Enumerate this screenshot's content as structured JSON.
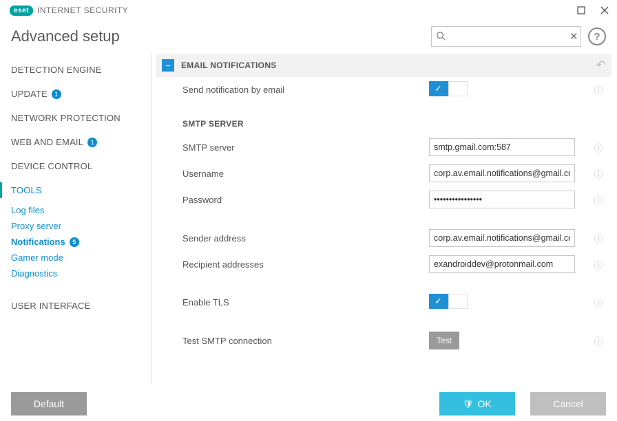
{
  "titlebar": {
    "brand": "eset",
    "product": "INTERNET SECURITY"
  },
  "header": {
    "title": "Advanced setup",
    "search_placeholder": ""
  },
  "sidebar": {
    "items": [
      {
        "label": "DETECTION ENGINE",
        "badge": null
      },
      {
        "label": "UPDATE",
        "badge": "1"
      },
      {
        "label": "NETWORK PROTECTION",
        "badge": null
      },
      {
        "label": "WEB AND EMAIL",
        "badge": "1"
      },
      {
        "label": "DEVICE CONTROL",
        "badge": null
      },
      {
        "label": "TOOLS",
        "badge": null
      },
      {
        "label": "USER INTERFACE",
        "badge": null
      }
    ],
    "tools_sub": [
      {
        "label": "Log files"
      },
      {
        "label": "Proxy server"
      },
      {
        "label": "Notifications",
        "badge": "5"
      },
      {
        "label": "Gamer mode"
      },
      {
        "label": "Diagnostics"
      }
    ]
  },
  "section": {
    "title": "EMAIL NOTIFICATIONS",
    "send_label": "Send notification by email",
    "send_on": true,
    "smtp_title": "SMTP SERVER",
    "server_label": "SMTP server",
    "server_value": "smtp.gmail.com:587",
    "user_label": "Username",
    "user_value": "corp.av.email.notifications@gmail.com",
    "pass_label": "Password",
    "pass_value": "••••••••••••••••",
    "sender_label": "Sender address",
    "sender_value": "corp.av.email.notifications@gmail.com",
    "recip_label": "Recipient addresses",
    "recip_value": "exandroiddev@protonmail.com",
    "tls_label": "Enable TLS",
    "tls_on": true,
    "test_label": "Test SMTP connection",
    "test_btn": "Test"
  },
  "footer": {
    "default": "Default",
    "ok": "OK",
    "cancel": "Cancel"
  }
}
